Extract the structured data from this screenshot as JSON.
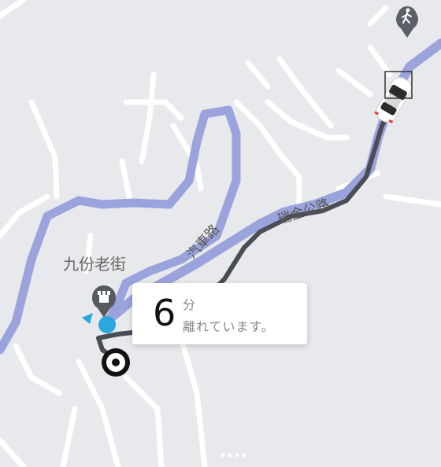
{
  "map": {
    "place_label": "九份老街",
    "road_label_1": "汽車路",
    "road_label_2": "瑞金公路",
    "colors": {
      "background": "#e8e9ec",
      "minor_road": "#ffffff",
      "major_road": "#9aa3dc",
      "route": "#4a4d55",
      "pin_dark": "#555a60",
      "location_blue": "#2aa7dd"
    },
    "icons": [
      "hiker-pin-icon",
      "landmark-pin-icon",
      "car-icon",
      "destination-marker-icon",
      "current-location-icon"
    ]
  },
  "eta": {
    "number": "6",
    "unit": "分",
    "text": "離れています。"
  }
}
